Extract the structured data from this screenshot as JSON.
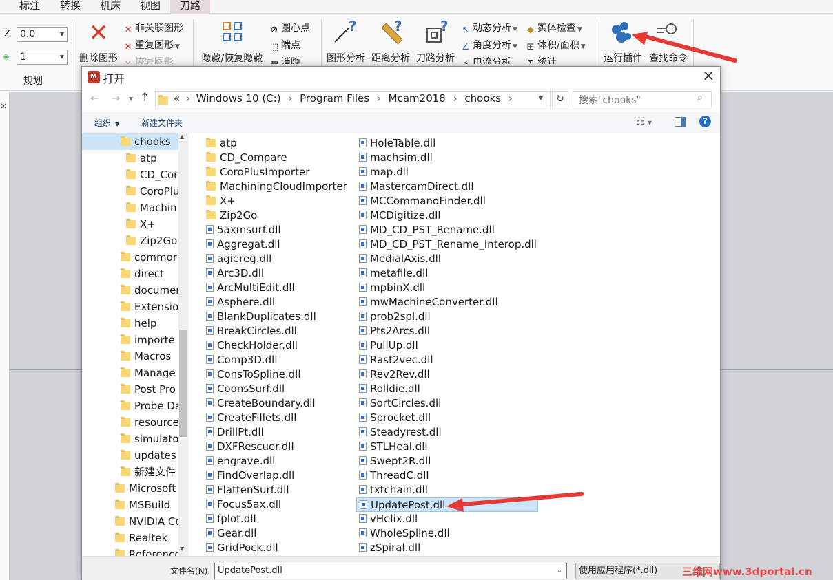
{
  "menu": [
    "标注",
    "转换",
    "机床",
    "视图",
    "刀路"
  ],
  "ribbon": {
    "plan": {
      "z_label": "Z",
      "z_value": "0.0",
      "level_value": "1",
      "group_label": "规划"
    },
    "delete_figure": "删除图形",
    "small_group1": [
      "非关联图形",
      "重复图形",
      "恢复图形"
    ],
    "hide_restore": "隐藏/恢复隐藏",
    "small_group2": [
      "圆心点",
      "端点",
      "消隐"
    ],
    "figure_analysis": "图形分析",
    "distance_analysis": "距离分析",
    "toolpath_analysis": "刀路分析",
    "small_group3": [
      "动态分析",
      "角度分析",
      "电流分析"
    ],
    "small_group4": [
      "实体检查",
      "体积/面积",
      "统计"
    ],
    "run_addin": "运行插件",
    "find_command": "查找命令"
  },
  "dialog": {
    "title": "打开",
    "breadcrumb": [
      "«",
      "Windows 10 (C:)",
      "Program Files",
      "Mcam2018",
      "chooks"
    ],
    "search_placeholder": "搜索\"chooks\"",
    "organize": "组织",
    "new_folder": "新建文件夹",
    "tree": [
      {
        "label": "chooks",
        "level": 1,
        "selected": true
      },
      {
        "label": "atp",
        "level": 2
      },
      {
        "label": "CD_Cor",
        "level": 2
      },
      {
        "label": "CoroPlu",
        "level": 2
      },
      {
        "label": "Machin",
        "level": 2
      },
      {
        "label": "X+",
        "level": 2
      },
      {
        "label": "Zip2Go",
        "level": 2
      },
      {
        "label": "commor",
        "level": 1
      },
      {
        "label": "direct",
        "level": 1
      },
      {
        "label": "documer",
        "level": 1
      },
      {
        "label": "Extensio",
        "level": 1
      },
      {
        "label": "help",
        "level": 1
      },
      {
        "label": "importe",
        "level": 1
      },
      {
        "label": "Macros",
        "level": 1
      },
      {
        "label": "Manage",
        "level": 1
      },
      {
        "label": "Post Pro",
        "level": 1
      },
      {
        "label": "Probe Da",
        "level": 1
      },
      {
        "label": "resource",
        "level": 1
      },
      {
        "label": "simulato",
        "level": 1
      },
      {
        "label": "updates",
        "level": 1
      },
      {
        "label": "新建文件",
        "level": 1
      },
      {
        "label": "Microsoft",
        "level": 0
      },
      {
        "label": "MSBuild",
        "level": 0
      },
      {
        "label": "NVIDIA Co",
        "level": 0
      },
      {
        "label": "Realtek",
        "level": 0
      },
      {
        "label": "Reference",
        "level": 0
      }
    ],
    "col1": [
      {
        "name": "atp",
        "type": "folder"
      },
      {
        "name": "CD_Compare",
        "type": "folder"
      },
      {
        "name": "CoroPlusImporter",
        "type": "folder"
      },
      {
        "name": "MachiningCloudImporter",
        "type": "folder"
      },
      {
        "name": "X+",
        "type": "folder"
      },
      {
        "name": "Zip2Go",
        "type": "folder"
      },
      {
        "name": "5axmsurf.dll",
        "type": "dll"
      },
      {
        "name": "Aggregat.dll",
        "type": "dll"
      },
      {
        "name": "agiereg.dll",
        "type": "dll"
      },
      {
        "name": "Arc3D.dll",
        "type": "dll"
      },
      {
        "name": "ArcMultiEdit.dll",
        "type": "dll"
      },
      {
        "name": "Asphere.dll",
        "type": "dll"
      },
      {
        "name": "BlankDuplicates.dll",
        "type": "dll"
      },
      {
        "name": "BreakCircles.dll",
        "type": "dll"
      },
      {
        "name": "CheckHolder.dll",
        "type": "dll"
      },
      {
        "name": "Comp3D.dll",
        "type": "dll"
      },
      {
        "name": "ConsToSpline.dll",
        "type": "dll"
      },
      {
        "name": "CoonsSurf.dll",
        "type": "dll"
      },
      {
        "name": "CreateBoundary.dll",
        "type": "dll"
      },
      {
        "name": "CreateFillets.dll",
        "type": "dll"
      },
      {
        "name": "DrillPt.dll",
        "type": "dll"
      },
      {
        "name": "DXFRescuer.dll",
        "type": "dll"
      },
      {
        "name": "engrave.dll",
        "type": "dll"
      },
      {
        "name": "FindOverlap.dll",
        "type": "dll"
      },
      {
        "name": "FlattenSurf.dll",
        "type": "dll"
      },
      {
        "name": "Focus5ax.dll",
        "type": "dll"
      },
      {
        "name": "fplot.dll",
        "type": "dll"
      },
      {
        "name": "Gear.dll",
        "type": "dll"
      },
      {
        "name": "GridPock.dll",
        "type": "dll"
      }
    ],
    "col2": [
      {
        "name": "HoleTable.dll",
        "type": "dll"
      },
      {
        "name": "machsim.dll",
        "type": "dll"
      },
      {
        "name": "map.dll",
        "type": "dll"
      },
      {
        "name": "MastercamDirect.dll",
        "type": "dll"
      },
      {
        "name": "MCCommandFinder.dll",
        "type": "dll"
      },
      {
        "name": "MCDigitize.dll",
        "type": "dll"
      },
      {
        "name": "MD_CD_PST_Rename.dll",
        "type": "dll"
      },
      {
        "name": "MD_CD_PST_Rename_Interop.dll",
        "type": "dll"
      },
      {
        "name": "MedialAxis.dll",
        "type": "dll"
      },
      {
        "name": "metafile.dll",
        "type": "dll"
      },
      {
        "name": "mpbinX.dll",
        "type": "dll"
      },
      {
        "name": "mwMachineConverter.dll",
        "type": "dll"
      },
      {
        "name": "prob2spl.dll",
        "type": "dll"
      },
      {
        "name": "Pts2Arcs.dll",
        "type": "dll"
      },
      {
        "name": "PullUp.dll",
        "type": "dll"
      },
      {
        "name": "Rast2vec.dll",
        "type": "dll"
      },
      {
        "name": "Rev2Rev.dll",
        "type": "dll"
      },
      {
        "name": "Rolldie.dll",
        "type": "dll"
      },
      {
        "name": "SortCircles.dll",
        "type": "dll"
      },
      {
        "name": "Sprocket.dll",
        "type": "dll"
      },
      {
        "name": "Steadyrest.dll",
        "type": "dll"
      },
      {
        "name": "STLHeal.dll",
        "type": "dll"
      },
      {
        "name": "Swept2R.dll",
        "type": "dll"
      },
      {
        "name": "ThreadC.dll",
        "type": "dll"
      },
      {
        "name": "txtchain.dll",
        "type": "dll"
      },
      {
        "name": "UpdatePost.dll",
        "type": "dll",
        "selected": true
      },
      {
        "name": "vHelix.dll",
        "type": "dll"
      },
      {
        "name": "WholeSpline.dll",
        "type": "dll"
      },
      {
        "name": "zSpiral.dll",
        "type": "dll"
      }
    ],
    "filename_label": "文件名(N):",
    "filename_value": "UpdatePost.dll",
    "filter_value": "使用应用程序(*.dll)"
  },
  "watermark": "三维网www.3dportal.cn",
  "colors": {
    "accent": "#0078d7",
    "arrow": "#e53935",
    "selection": "#cce4f7"
  }
}
